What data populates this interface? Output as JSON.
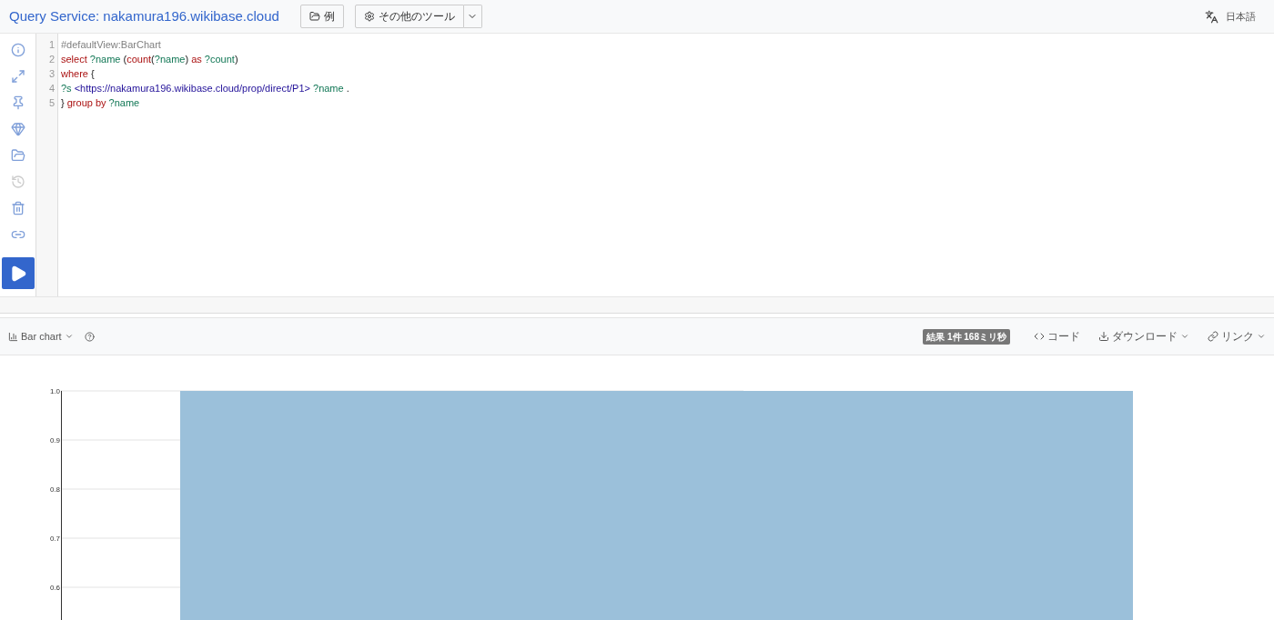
{
  "header": {
    "title": "Query Service: nakamura196.wikibase.cloud",
    "examples_button": "例",
    "tools_button": "その他のツール",
    "language": "日本語"
  },
  "sidebar": {
    "items": [
      {
        "kind": "info",
        "disabled": false
      },
      {
        "kind": "expand",
        "disabled": false
      },
      {
        "kind": "pin",
        "disabled": false
      },
      {
        "kind": "diamond",
        "disabled": false
      },
      {
        "kind": "folder",
        "disabled": false
      },
      {
        "kind": "history",
        "disabled": true
      },
      {
        "kind": "trash",
        "disabled": false
      },
      {
        "kind": "link",
        "disabled": false
      }
    ]
  },
  "editor": {
    "lines": [
      {
        "number": "1",
        "tokens": [
          {
            "kind": "comment",
            "text": "#defaultView:BarChart"
          }
        ]
      },
      {
        "number": "2",
        "tokens": [
          {
            "kind": "keyword",
            "text": "select"
          },
          {
            "kind": "variable",
            "text": " ?name"
          },
          {
            "kind": "plain",
            "text": " ("
          },
          {
            "kind": "keyword",
            "text": "count"
          },
          {
            "kind": "plain",
            "text": "("
          },
          {
            "kind": "variable",
            "text": "?name"
          },
          {
            "kind": "plain",
            "text": ") "
          },
          {
            "kind": "keyword",
            "text": "as"
          },
          {
            "kind": "variable",
            "text": " ?count"
          },
          {
            "kind": "plain",
            "text": ")"
          }
        ]
      },
      {
        "number": "3",
        "tokens": [
          {
            "kind": "keyword",
            "text": "where"
          },
          {
            "kind": "plain",
            "text": " {"
          }
        ]
      },
      {
        "number": "4",
        "tokens": [
          {
            "kind": "variable",
            "text": "?s"
          },
          {
            "kind": "iri",
            "text": " <https://nakamura196.wikibase.cloud/prop/direct/P1>"
          },
          {
            "kind": "variable",
            "text": " ?name"
          },
          {
            "kind": "plain",
            "text": " ."
          }
        ]
      },
      {
        "number": "5",
        "tokens": [
          {
            "kind": "plain",
            "text": "} "
          },
          {
            "kind": "keyword",
            "text": "group by"
          },
          {
            "kind": "variable",
            "text": " ?name"
          }
        ]
      }
    ]
  },
  "results_toolbar": {
    "view_menu": "Bar chart",
    "result_badge": "結果 1件 168ミリ秒",
    "code_link": "コード",
    "download_menu": "ダウンロード",
    "link_menu": "リンク"
  },
  "chart": {
    "chart_data": {
      "type": "bar",
      "grid": true,
      "series": [
        {
          "color": "#9bc0da",
          "values": [
            1
          ]
        }
      ],
      "ylim": [
        0.5333,
        1
      ],
      "yticks": [
        0.6,
        0.7,
        0.8,
        0.9,
        {
          "value": 1,
          "label": "1.0"
        }
      ]
    }
  }
}
